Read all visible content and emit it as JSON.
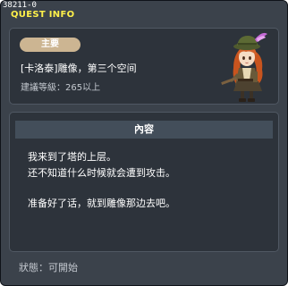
{
  "window": {
    "quest_id": "38211-0",
    "title": "QUEST INFO"
  },
  "summary": {
    "badge_label": "主要",
    "quest_name": "[卡洛泰]雕像，第三个空间",
    "recommended_level": "建議等級：265以上"
  },
  "content": {
    "header": "內容",
    "lines": [
      "我来到了塔的上层。",
      "还不知道什么时候就会遭到攻击。",
      "",
      "准备好了话，就到雕像那边去吧。"
    ]
  },
  "status": {
    "text": "狀態：可開始"
  },
  "colors": {
    "title_yellow": "#fff14a",
    "badge_tan": "#ccb592",
    "window_bg": "#3b424b",
    "panel_bg": "#2d333b",
    "header_bg": "#434e5a"
  },
  "icons": {
    "npc": "npc-portrait-icon"
  }
}
